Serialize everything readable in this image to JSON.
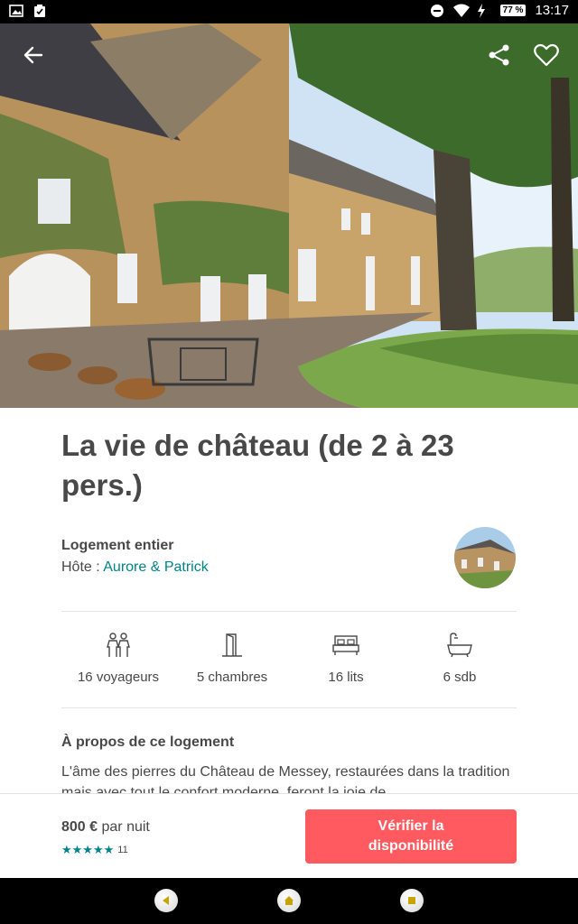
{
  "status_bar": {
    "battery": "77 %",
    "time": "13:17"
  },
  "hero": {
    "icons": [
      "back-arrow-icon",
      "share-icon",
      "heart-icon"
    ]
  },
  "listing": {
    "title": "La vie de château (de 2 à 23 pers.)",
    "type": "Logement entier",
    "host_prefix": "Hôte : ",
    "host_name": "Aurore & Patrick",
    "amenities": [
      {
        "icon": "guests-icon",
        "label": "16 voyageurs"
      },
      {
        "icon": "door-icon",
        "label": "5 chambres"
      },
      {
        "icon": "bed-icon",
        "label": "16 lits"
      },
      {
        "icon": "bathtub-icon",
        "label": "6 sdb"
      }
    ],
    "about_title": "À propos de ce logement",
    "about_text": "L'âme des pierres du Château de Messey, restaurées dans la tradition mais avec tout le confort moderne, feront la joie de"
  },
  "booking": {
    "price": "800 €",
    "price_unit": " par nuit",
    "stars": "★★★★★",
    "review_count": "11",
    "cta_label": "Vérifier la disponibilité"
  },
  "colors": {
    "accent": "#ff5a5f",
    "teal": "#008489",
    "text": "#484848"
  }
}
